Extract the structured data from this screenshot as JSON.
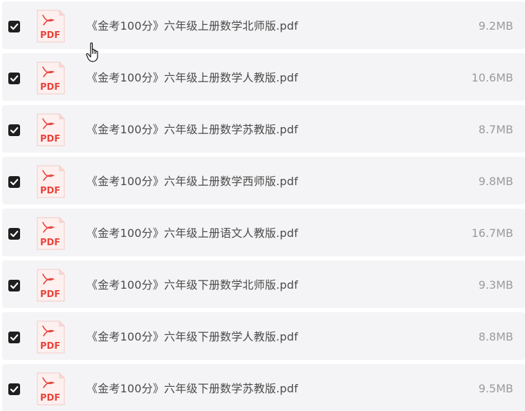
{
  "files": [
    {
      "name": "《金考100分》六年级上册数学北师版.pdf",
      "size": "9.2MB",
      "checked": true,
      "icon": "pdf-file-icon",
      "icon_label": "PDF"
    },
    {
      "name": "《金考100分》六年级上册数学人教版.pdf",
      "size": "10.6MB",
      "checked": true,
      "icon": "pdf-file-icon",
      "icon_label": "PDF"
    },
    {
      "name": "《金考100分》六年级上册数学苏教版.pdf",
      "size": "8.7MB",
      "checked": true,
      "icon": "pdf-file-icon",
      "icon_label": "PDF"
    },
    {
      "name": "《金考100分》六年级上册数学西师版.pdf",
      "size": "9.8MB",
      "checked": true,
      "icon": "pdf-file-icon",
      "icon_label": "PDF"
    },
    {
      "name": "《金考100分》六年级上册语文人教版.pdf",
      "size": "16.7MB",
      "checked": true,
      "icon": "pdf-file-icon",
      "icon_label": "PDF"
    },
    {
      "name": "《金考100分》六年级下册数学北师版.pdf",
      "size": "9.3MB",
      "checked": true,
      "icon": "pdf-file-icon",
      "icon_label": "PDF"
    },
    {
      "name": "《金考100分》六年级下册数学人教版.pdf",
      "size": "8.8MB",
      "checked": true,
      "icon": "pdf-file-icon",
      "icon_label": "PDF"
    },
    {
      "name": "《金考100分》六年级下册数学苏教版.pdf",
      "size": "9.5MB",
      "checked": true,
      "icon": "pdf-file-icon",
      "icon_label": "PDF"
    }
  ],
  "colors": {
    "row_background": "#f4f4f6",
    "pdf_red": "#e8453c",
    "checkbox": "#1f1f1f"
  },
  "cursor": {
    "icon": "hand-pointer-icon"
  }
}
